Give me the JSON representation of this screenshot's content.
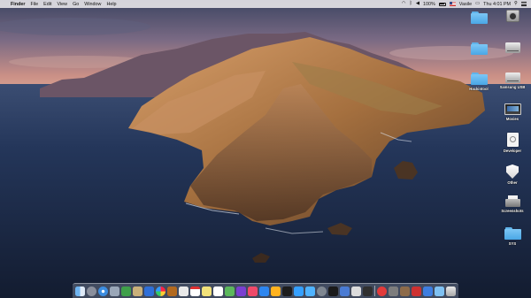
{
  "menubar": {
    "apple_glyph": "",
    "app_name": "Finder",
    "menus": [
      "File",
      "Edit",
      "View",
      "Go",
      "Window",
      "Help"
    ],
    "status": {
      "user": "Vasile",
      "battery": "100%",
      "clock": "Thu 4:01 PM"
    }
  },
  "desktop_icons": {
    "top1": {
      "label": ""
    },
    "macintosh_hd": {
      "label": ""
    },
    "top3": {
      "label": ""
    },
    "top4": {
      "label": ""
    },
    "folder_hackintool": {
      "label": "Hackintool"
    },
    "samsung_usb": {
      "label": "Samsung USB"
    },
    "movies": {
      "label": "Movies"
    },
    "developer": {
      "label": "Developer"
    },
    "other": {
      "label": "Other"
    },
    "screenshots": {
      "label": "Screenshots"
    },
    "sys": {
      "label": "SYS"
    }
  },
  "dock": {
    "items": [
      "finder-icon",
      "launchpad-icon",
      "safari-icon",
      "mail-icon",
      "contacts-icon",
      "calendar-icon",
      "notes-icon",
      "reminders-icon",
      "maps-icon",
      "photos-icon",
      "messages-icon",
      "facetime-icon",
      "itunes-icon",
      "books-icon",
      "app-store-icon",
      "system-preferences-icon",
      "terminal-icon",
      "activity-monitor-icon",
      "trash-icon"
    ]
  },
  "colors": {
    "sky_top": "#3c4a6a",
    "sky_glow": "#d79a86",
    "sea_dark": "#16223a",
    "folder_blue": "#5fb3ea"
  }
}
